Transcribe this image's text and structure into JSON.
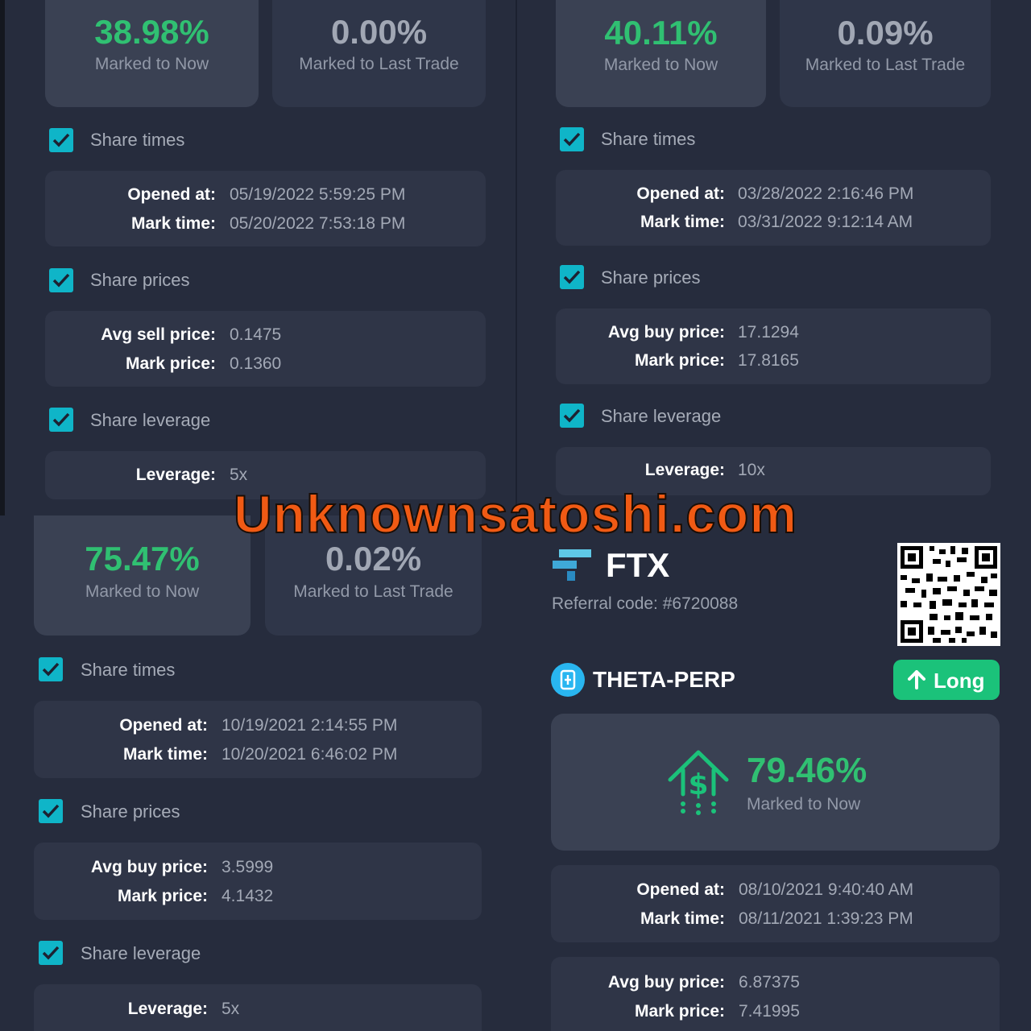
{
  "watermark": "Unknownsatoshi.com",
  "colors": {
    "green": "#30c072",
    "cyan": "#0fb5c8",
    "bg": "#262c3d",
    "card": "#2f3547",
    "orange": "#f05a14"
  },
  "panel1": {
    "stat_now": {
      "pct": "38.98%",
      "label": "Marked to Now"
    },
    "stat_last": {
      "pct": "0.00%",
      "label": "Marked to Last Trade"
    },
    "share_times_label": "Share times",
    "opened_key": "Opened at:",
    "opened_val": "05/19/2022 5:59:25 PM",
    "mark_time_key": "Mark time:",
    "mark_time_val": "05/20/2022 7:53:18 PM",
    "share_prices_label": "Share prices",
    "avg_key": "Avg sell price:",
    "avg_val": "0.1475",
    "mark_price_key": "Mark price:",
    "mark_price_val": "0.1360",
    "share_leverage_label": "Share leverage",
    "leverage_key": "Leverage:",
    "leverage_val": "5x"
  },
  "panel2": {
    "stat_now": {
      "pct": "40.11%",
      "label": "Marked to Now"
    },
    "stat_last": {
      "pct": "0.09%",
      "label": "Marked to Last Trade"
    },
    "share_times_label": "Share times",
    "opened_key": "Opened at:",
    "opened_val": "03/28/2022 2:16:46 PM",
    "mark_time_key": "Mark time:",
    "mark_time_val": "03/31/2022 9:12:14 AM",
    "share_prices_label": "Share prices",
    "avg_key": "Avg buy price:",
    "avg_val": "17.1294",
    "mark_price_key": "Mark price:",
    "mark_price_val": "17.8165",
    "share_leverage_label": "Share leverage",
    "leverage_key": "Leverage:",
    "leverage_val": "10x"
  },
  "panel3": {
    "stat_now": {
      "pct": "75.47%",
      "label": "Marked to Now"
    },
    "stat_last": {
      "pct": "0.02%",
      "label": "Marked to Last Trade"
    },
    "share_times_label": "Share times",
    "opened_key": "Opened at:",
    "opened_val": "10/19/2021 2:14:55 PM",
    "mark_time_key": "Mark time:",
    "mark_time_val": "10/20/2021 6:46:02 PM",
    "share_prices_label": "Share prices",
    "avg_key": "Avg buy price:",
    "avg_val": "3.5999",
    "mark_price_key": "Mark price:",
    "mark_price_val": "4.1432",
    "share_leverage_label": "Share leverage",
    "leverage_key": "Leverage:",
    "leverage_val": "5x"
  },
  "panel4": {
    "brand": "FTX",
    "referral": "Referral code: #6720088",
    "market": "THETA-PERP",
    "side_button": "Long",
    "stat_now": {
      "pct": "79.46%",
      "label": "Marked to Now"
    },
    "opened_key": "Opened at:",
    "opened_val": "08/10/2021 9:40:40 AM",
    "mark_time_key": "Mark time:",
    "mark_time_val": "08/11/2021 1:39:23 PM",
    "avg_key": "Avg buy price:",
    "avg_val": "6.87375",
    "mark_price_key": "Mark price:",
    "mark_price_val": "7.41995"
  }
}
